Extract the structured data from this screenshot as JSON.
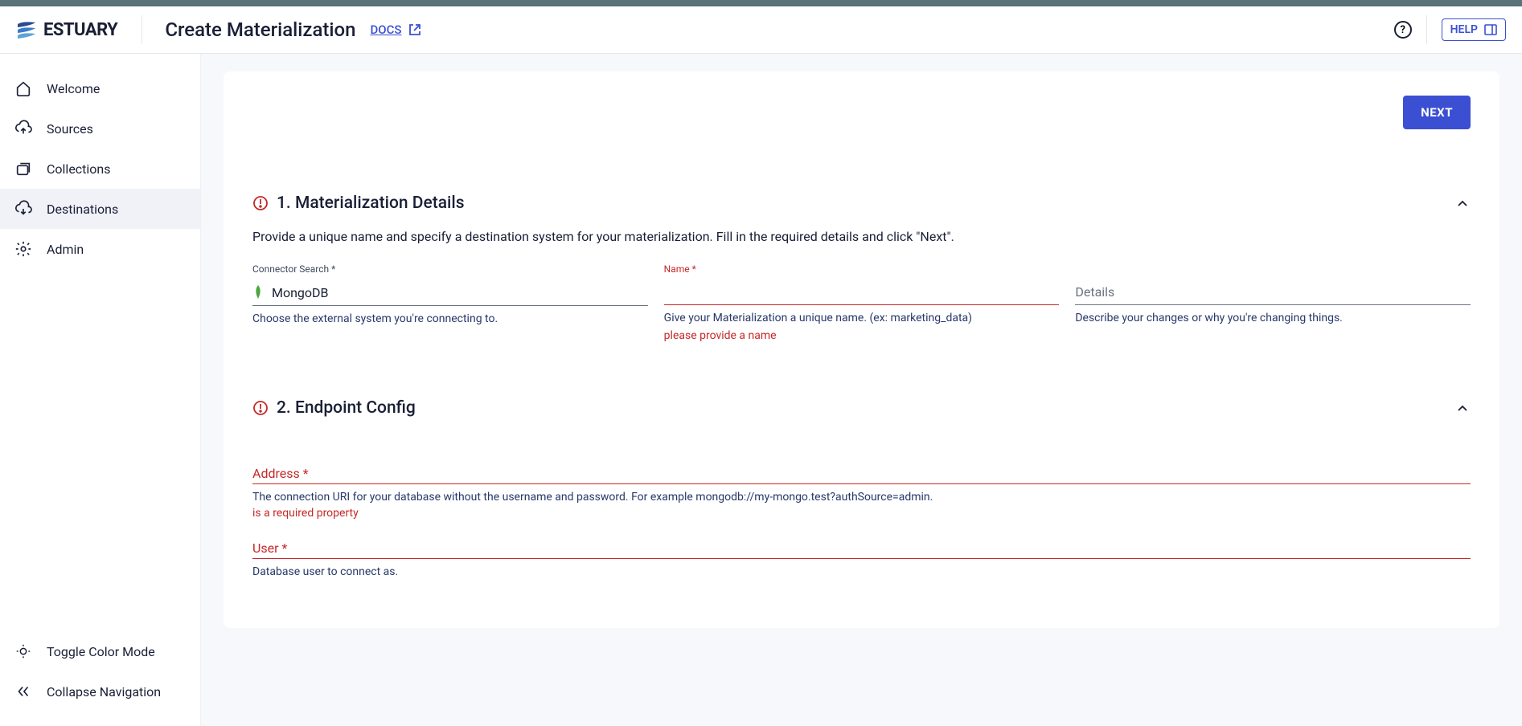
{
  "logo": {
    "text": "ESTUARY"
  },
  "header": {
    "title": "Create Materialization",
    "docs_label": "DOCS",
    "help_label": "HELP"
  },
  "sidebar": {
    "items": [
      {
        "label": "Welcome",
        "icon": "home"
      },
      {
        "label": "Sources",
        "icon": "cloud-up"
      },
      {
        "label": "Collections",
        "icon": "collection"
      },
      {
        "label": "Destinations",
        "icon": "cloud-down",
        "active": true
      },
      {
        "label": "Admin",
        "icon": "gear"
      }
    ],
    "toggle_color_label": "Toggle Color Mode",
    "collapse_label": "Collapse Navigation"
  },
  "actions": {
    "next_label": "NEXT"
  },
  "section1": {
    "title": "1. Materialization Details",
    "description": "Provide a unique name and specify a destination system for your materialization. Fill in the required details and click \"Next\".",
    "connector": {
      "label": "Connector Search *",
      "value": "MongoDB",
      "help": "Choose the external system you're connecting to."
    },
    "name": {
      "label": "Name *",
      "value": "",
      "help": "Give your Materialization a unique name. (ex: marketing_data)",
      "error": "please provide a name"
    },
    "details": {
      "placeholder": "Details",
      "help": "Describe your changes or why you're changing things."
    }
  },
  "section2": {
    "title": "2. Endpoint Config",
    "address": {
      "label": "Address *",
      "help": "The connection URI for your database without the username and password. For example mongodb://my-mongo.test?authSource=admin.",
      "error": "is a required property"
    },
    "user": {
      "label": "User *",
      "help": "Database user to connect as."
    }
  }
}
